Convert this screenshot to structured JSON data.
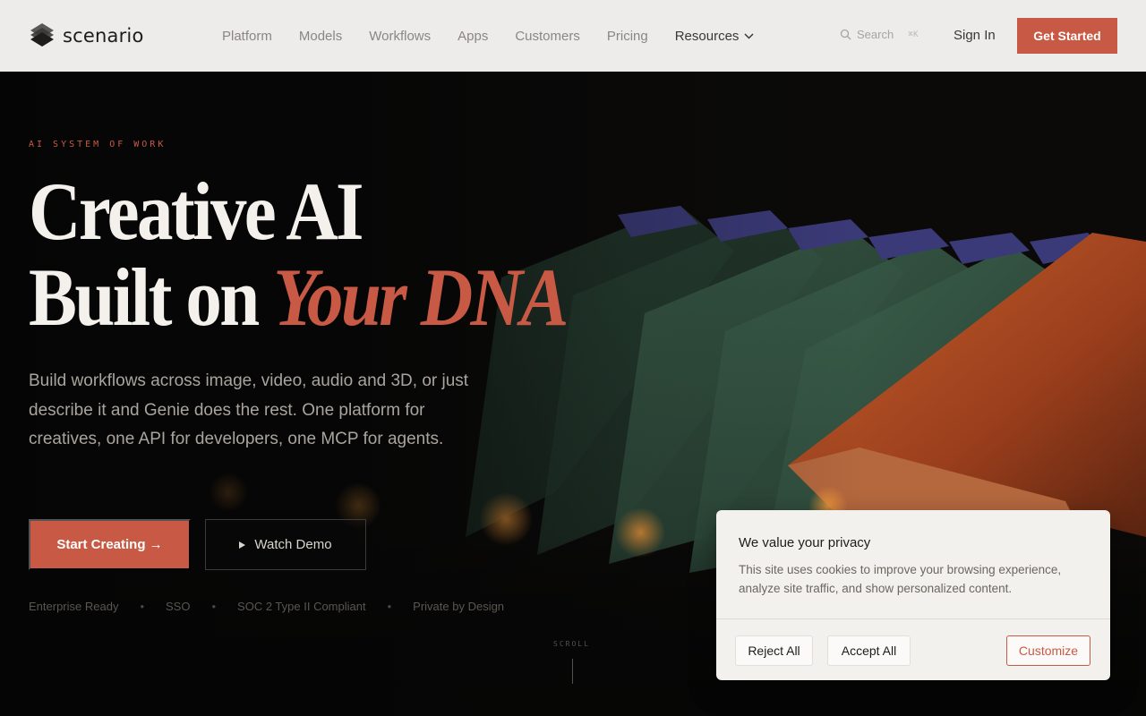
{
  "brand": {
    "name": "scenario",
    "accent": "#c85a45"
  },
  "nav": {
    "links": [
      "Platform",
      "Models",
      "Workflows",
      "Apps",
      "Customers",
      "Pricing"
    ],
    "resources": "Resources",
    "search_placeholder": "Search",
    "search_shortcut": "⌘K",
    "sign_in": "Sign In",
    "get_started": "Get Started"
  },
  "hero": {
    "eyebrow": "AI SYSTEM OF WORK",
    "headline_line1": "Creative AI",
    "headline_line2_plain": "Built on ",
    "headline_line2_accent": "Your DNA",
    "subheadline": "Build workflows across image, video, audio and 3D, or just describe it and Genie does the rest. One platform for creatives, one API for developers, one MCP for agents.",
    "primary_cta": "Start Creating →",
    "secondary_cta": "Watch Demo",
    "badges": [
      "Enterprise Ready",
      "SSO",
      "SOC 2 Type II Compliant",
      "Private by Design"
    ],
    "badge_separator": "•",
    "scroll_label": "SCROLL"
  },
  "cookie_banner": {
    "title": "We value your privacy",
    "body": "This site uses cookies to improve your browsing experience, analyze site traffic, and show personalized content.",
    "reject": "Reject All",
    "accept": "Accept All",
    "customize": "Customize"
  }
}
